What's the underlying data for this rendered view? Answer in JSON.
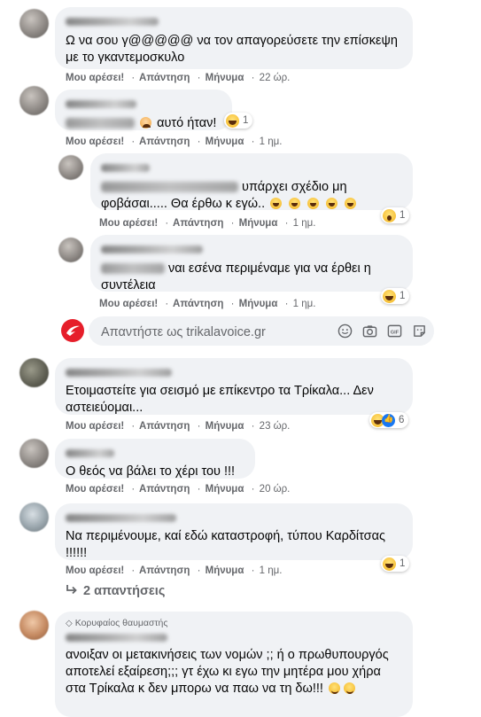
{
  "actions": {
    "like": "Μου αρέσει!",
    "reply": "Απάντηση",
    "message": "Μήνυμα",
    "separator": "·"
  },
  "comments": [
    {
      "text": "Ω να σου γ@@@@@ να τον απαγορεύσετε την επίσκεψη με το γκαντεμοσκυλο",
      "time": "22 ώρ."
    },
    {
      "text": "αυτό ήταν!",
      "time": "1 ημ.",
      "reaction_count": "1"
    },
    {
      "text_line1": "υπάρχει σχέδιο μη",
      "text_line2": "φοβάσαι..... Θα έρθω κ εγώ..",
      "time": "1 ημ.",
      "reaction_count": "1"
    },
    {
      "text_line1": "ναι εσένα περιμέναμε για να έρθει η",
      "text_line2": "συντέλεια",
      "time": "1 ημ.",
      "reaction_count": "1"
    },
    {
      "text": "Ετοιμαστείτε για σεισμό με επίκεντρο τα Τρίκαλα... Δεν αστειεύομαι...",
      "time": "23 ώρ.",
      "reaction_count": "6"
    },
    {
      "text": "Ο θεός να βάλει το χέρι του !!!",
      "time": "20 ώρ."
    },
    {
      "text": "Να περιμένουμε, καί εδώ καταστροφή, τύπου Καρδίτσας !!!!!!",
      "time": "1 ημ.",
      "reaction_count": "1"
    },
    {
      "badge": "Κορυφαίος θαυμαστής",
      "text": "ανοιξαν οι μετακινήσεις των νομών ;; ή ο πρωθυπουργός αποτελεί εξαίρεση;;; γτ έχω κι εγω την μητέρα μου χήρα στα Τρίκαλα κ δεν μπορω να παω να τη δω!!!"
    }
  ],
  "reply_box": {
    "placeholder": "Απαντήστε ως trikalavoice.gr",
    "icons": [
      "emoji-icon",
      "camera-icon",
      "gif-icon",
      "sticker-icon"
    ]
  },
  "replies_link": "2 απαντήσεις",
  "colors": {
    "bubble": "#f0f2f5",
    "meta": "#65676b",
    "text": "#050505",
    "brand_logo": "#e61e2a"
  }
}
